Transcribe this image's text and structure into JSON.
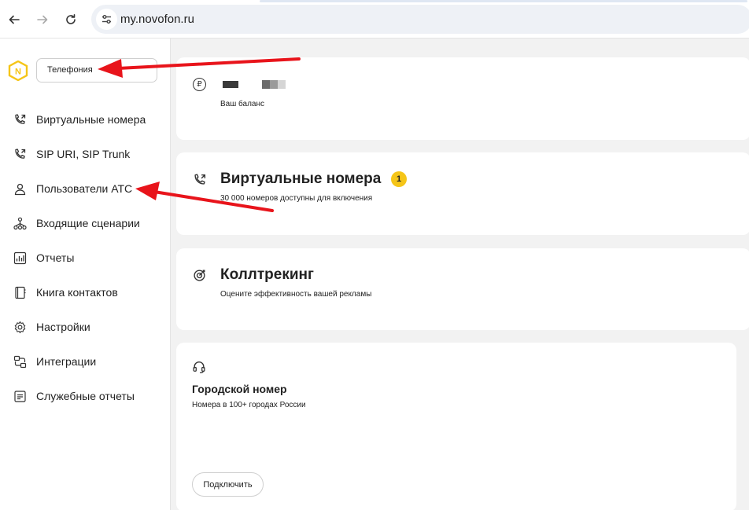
{
  "browser": {
    "url": "my.novofon.ru"
  },
  "sidebar": {
    "section_select": "Телефония",
    "items": [
      {
        "label": "Виртуальные номера",
        "icon": "phone-icon"
      },
      {
        "label": "SIP URI, SIP Trunk",
        "icon": "phone-icon"
      },
      {
        "label": "Пользователи АТС",
        "icon": "user-icon"
      },
      {
        "label": "Входящие сценарии",
        "icon": "scenario-icon"
      },
      {
        "label": "Отчеты",
        "icon": "chart-icon"
      },
      {
        "label": "Книга контактов",
        "icon": "book-icon"
      },
      {
        "label": "Настройки",
        "icon": "gear-icon"
      },
      {
        "label": "Интеграции",
        "icon": "integration-icon"
      },
      {
        "label": "Служебные отчеты",
        "icon": "document-icon"
      }
    ]
  },
  "main": {
    "balance": {
      "label": "Ваш баланс",
      "icon": "ruble-icon"
    },
    "virtual_numbers": {
      "title": "Виртуальные номера",
      "badge": "1",
      "subtitle": "30 000 номеров доступны для включения",
      "icon": "phone-icon"
    },
    "calltracking": {
      "title": "Коллтрекинг",
      "subtitle": "Оцените эффективность вашей рекламы",
      "icon": "target-icon"
    },
    "city_number": {
      "title": "Городской номер",
      "subtitle": "Номера в 100+ городах России",
      "button": "Подключить",
      "icon": "headset-icon"
    }
  },
  "colors": {
    "accent_yellow": "#f5c518",
    "annotation_red": "#e8141b",
    "main_bg": "#f2f2f2"
  }
}
